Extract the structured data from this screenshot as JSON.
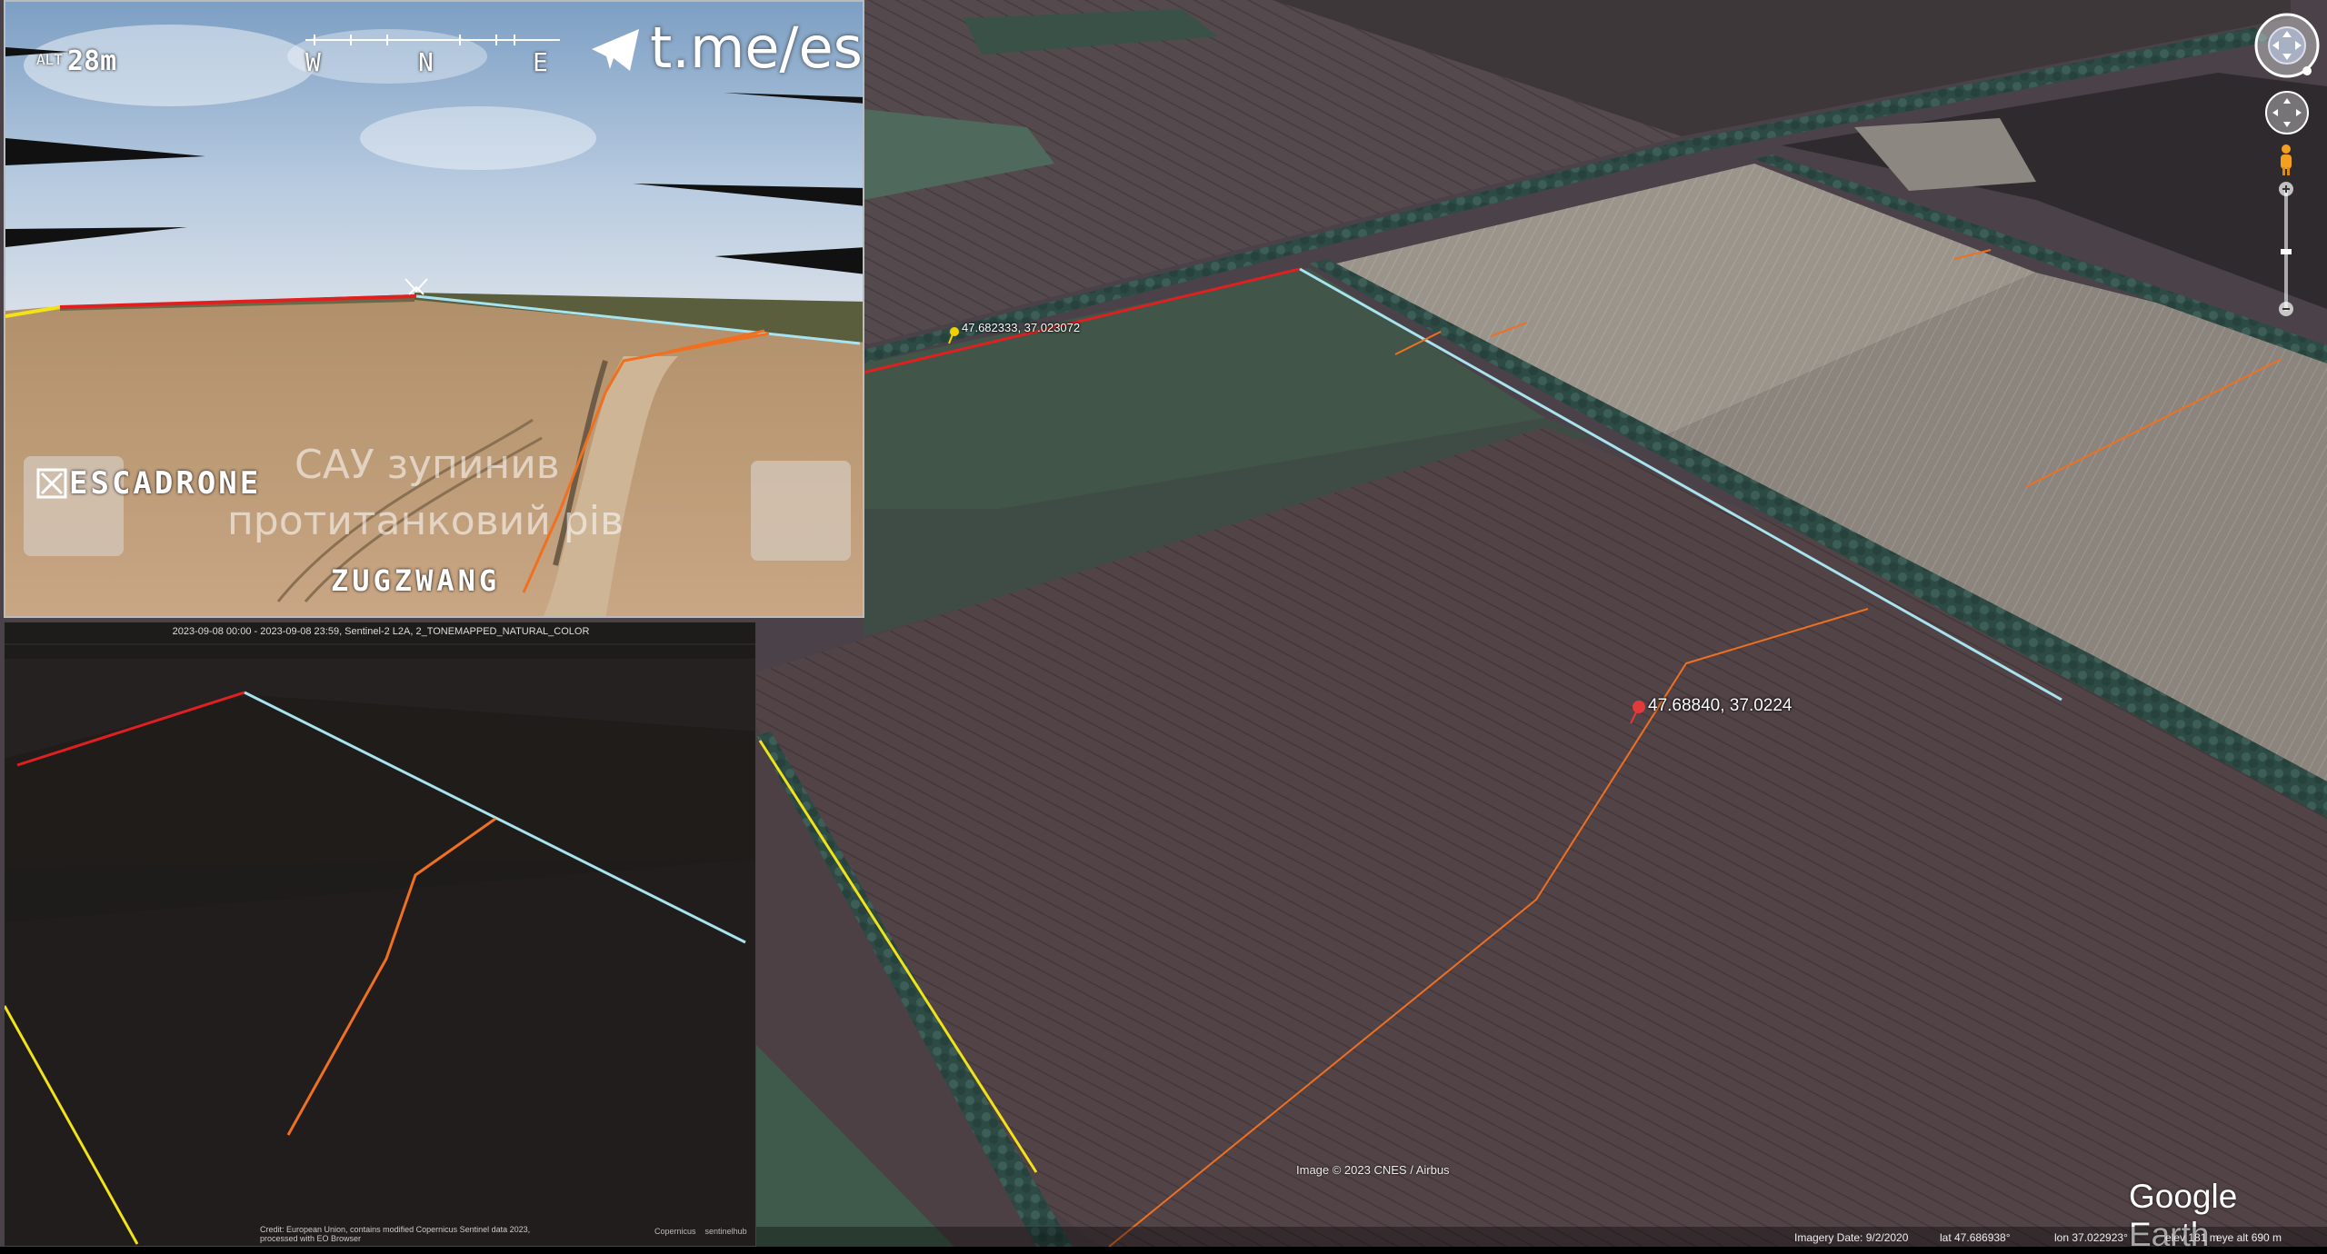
{
  "drone_feed": {
    "alt_label": "ALT",
    "alt_value": "28m",
    "compass": [
      "W",
      "N",
      "E"
    ],
    "telegram_text": "t.me/esca",
    "overlay_line1": "САУ зупинив",
    "overlay_line2": "протитанковий рів",
    "escadrone_text": "ESCADRONE",
    "zugzwang_text": "ZUGZWANG"
  },
  "sentinel_panel": {
    "header": "2023-09-08 00:00 - 2023-09-08 23:59, Sentinel-2 L2A, 2_TONEMAPPED_NATURAL_COLOR",
    "credit_line1": "Credit: European Union, contains modified Copernicus Sentinel data 2023,",
    "credit_line2": "processed with EO Browser",
    "logo1": "Copernicus",
    "logo2": "sentinelhub"
  },
  "earth_view": {
    "pin_yellow_label": "47.682333, 37.023072",
    "pin_red_label": "47.68840,  37.0224",
    "image_credit": "Image © 2023 CNES / Airbus",
    "logo": "Google Earth",
    "status_bar": {
      "imagery_date": "Imagery Date: 9/2/2020",
      "lat": "lat   47.686938°",
      "lon": "lon   37.022923°",
      "elev": "elev   181 m",
      "eye_alt": "eye alt    690 m"
    }
  },
  "colors": {
    "red_line": "#e02020",
    "cyan_line": "#a8e4f0",
    "orange_line": "#f07020",
    "yellow_line": "#f2e21a"
  },
  "icons": {
    "look_control": "look-joystick-icon",
    "move_control": "move-joystick-icon",
    "street_view": "pegman-icon",
    "zoom_in": "plus-icon",
    "zoom_out": "minus-icon",
    "pin": "pushpin-icon",
    "telegram": "telegram-icon"
  }
}
